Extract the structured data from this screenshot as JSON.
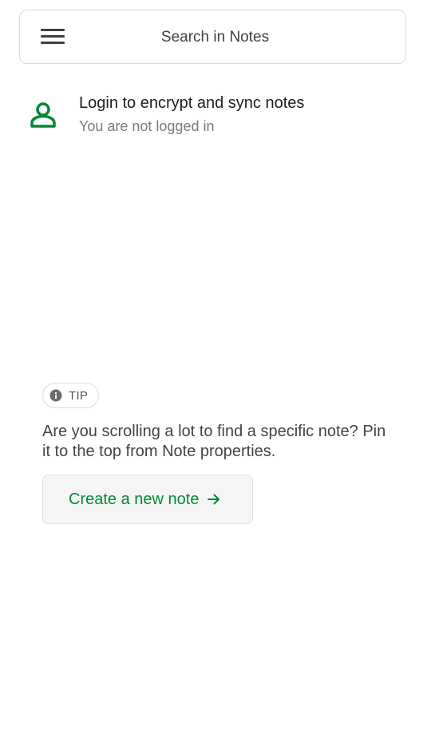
{
  "search": {
    "placeholder": "Search in Notes"
  },
  "login": {
    "title": "Login to encrypt and sync notes",
    "subtitle": "You are not logged in"
  },
  "tip": {
    "badge": "TIP",
    "text": "Are you scrolling a lot to find a specific note? Pin it to the top from Note properties."
  },
  "actions": {
    "create_label": "Create a new note"
  },
  "icons": {
    "menu": "menu-icon",
    "user": "user-icon",
    "info": "info-icon",
    "arrow": "arrow-right-icon"
  },
  "colors": {
    "accent": "#008837",
    "border": "#dcdcdc",
    "button_bg": "#f5f5f5"
  }
}
